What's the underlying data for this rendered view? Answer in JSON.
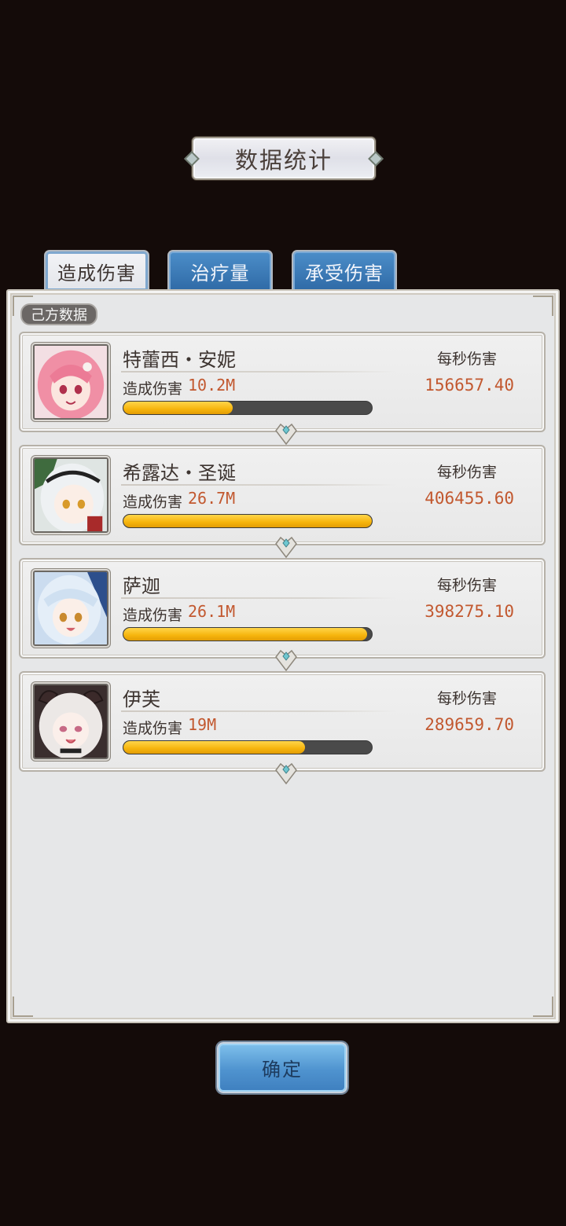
{
  "title": "数据统计",
  "tabs": [
    {
      "label": "造成伤害",
      "active": true
    },
    {
      "label": "治疗量",
      "active": false
    },
    {
      "label": "承受伤害",
      "active": false
    }
  ],
  "section_label": "己方数据",
  "rows": [
    {
      "name": "特蕾西・安妮",
      "damage_label": "造成伤害",
      "damage": "10.2M",
      "dps_label": "每秒伤害",
      "dps": "156657.40",
      "progress": 0.44,
      "portrait": "pink-hair-girl"
    },
    {
      "name": "希露达・圣诞",
      "damage_label": "造成伤害",
      "damage": "26.7M",
      "dps_label": "每秒伤害",
      "dps": "406455.60",
      "progress": 1.0,
      "portrait": "white-hair-christmas-girl"
    },
    {
      "name": "萨迦",
      "damage_label": "造成伤害",
      "damage": "26.1M",
      "dps_label": "每秒伤害",
      "dps": "398275.10",
      "progress": 0.98,
      "portrait": "silver-blue-hair-girl"
    },
    {
      "name": "伊芙",
      "damage_label": "造成伤害",
      "damage": "19M",
      "dps_label": "每秒伤害",
      "dps": "289659.70",
      "progress": 0.73,
      "portrait": "white-hair-horned-girl"
    }
  ],
  "confirm_label": "确定",
  "colors": {
    "accent_orange": "#c2582f",
    "bar_yellow": "#f6b40c",
    "tab_blue": "#3b7ab8"
  }
}
